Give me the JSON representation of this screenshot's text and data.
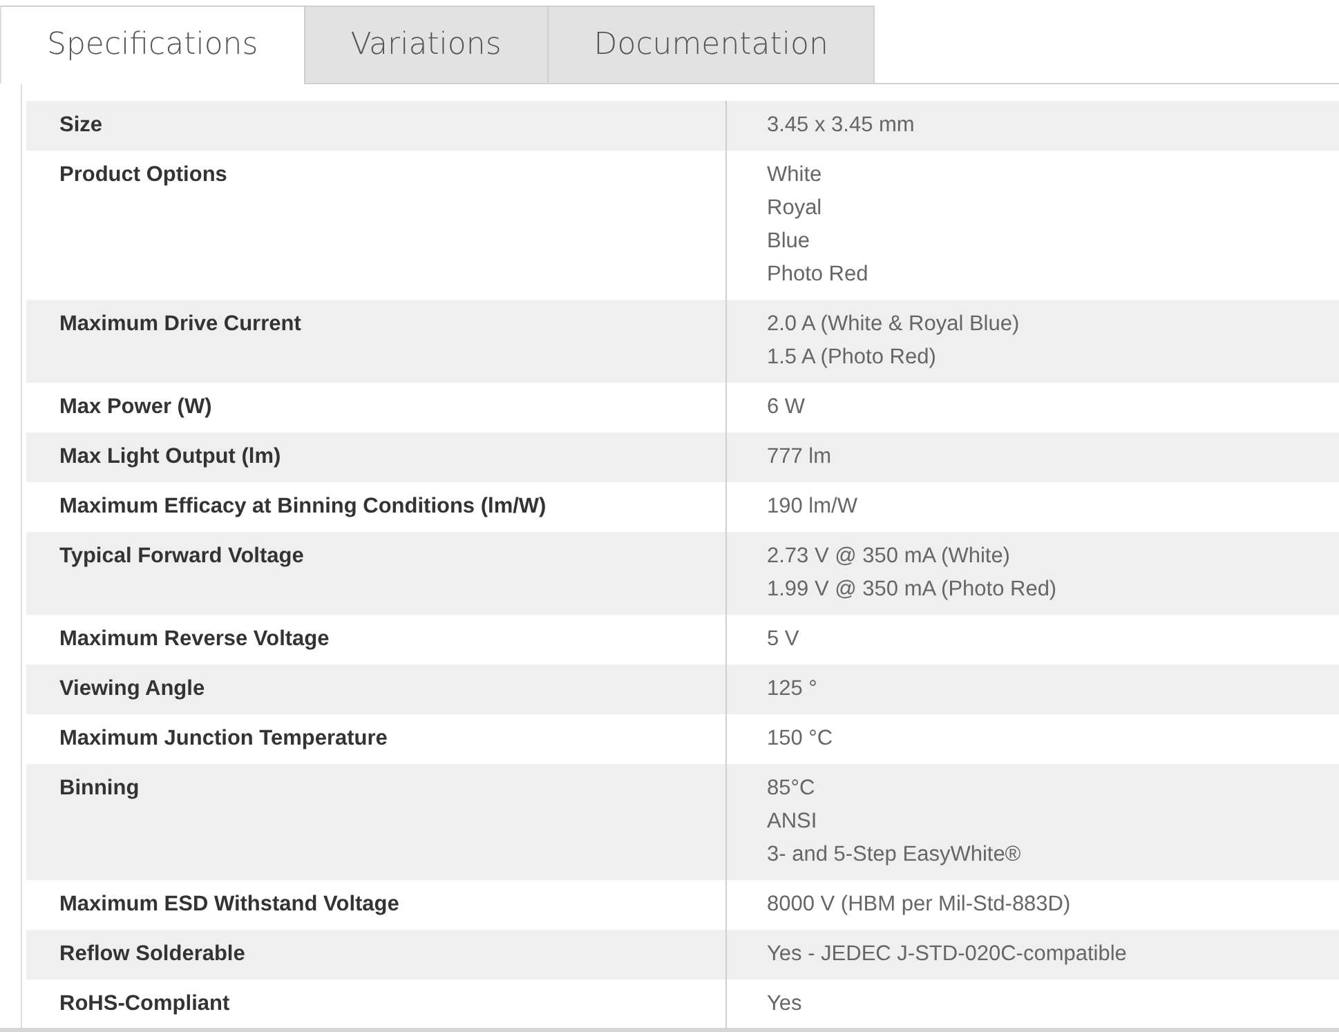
{
  "tabs": [
    {
      "label": "Specifications",
      "selected": true
    },
    {
      "label": "Variations",
      "selected": false
    },
    {
      "label": "Documentation",
      "selected": false
    }
  ],
  "specs": [
    {
      "label": "Size",
      "values": [
        "3.45 x 3.45 mm"
      ]
    },
    {
      "label": "Product Options",
      "values": [
        "White",
        "Royal",
        "Blue",
        "Photo Red"
      ]
    },
    {
      "label": "Maximum Drive Current",
      "values": [
        "2.0 A (White & Royal Blue)",
        "1.5 A (Photo Red)"
      ]
    },
    {
      "label": "Max Power (W)",
      "values": [
        "6 W"
      ]
    },
    {
      "label": "Max Light Output (lm)",
      "values": [
        "777 lm"
      ]
    },
    {
      "label": "Maximum Efficacy at Binning Conditions (lm/W)",
      "values": [
        "190 lm/W"
      ]
    },
    {
      "label": "Typical Forward Voltage",
      "values": [
        "2.73 V @ 350 mA (White)",
        "1.99 V @ 350 mA (Photo Red)"
      ]
    },
    {
      "label": "Maximum Reverse Voltage",
      "values": [
        "5 V"
      ]
    },
    {
      "label": "Viewing Angle",
      "values": [
        "125 °"
      ]
    },
    {
      "label": "Maximum Junction Temperature",
      "values": [
        "150 °C"
      ]
    },
    {
      "label": "Binning",
      "values": [
        "85°C",
        "ANSI",
        "3- and 5-Step EasyWhite®"
      ]
    },
    {
      "label": "Maximum ESD Withstand Voltage",
      "values": [
        "8000 V (HBM per Mil-Std-883D)"
      ]
    },
    {
      "label": "Reflow Solderable",
      "values": [
        "Yes - JEDEC J-STD-020C-compatible"
      ]
    },
    {
      "label": "RoHS-Compliant",
      "values": [
        "Yes"
      ]
    }
  ]
}
